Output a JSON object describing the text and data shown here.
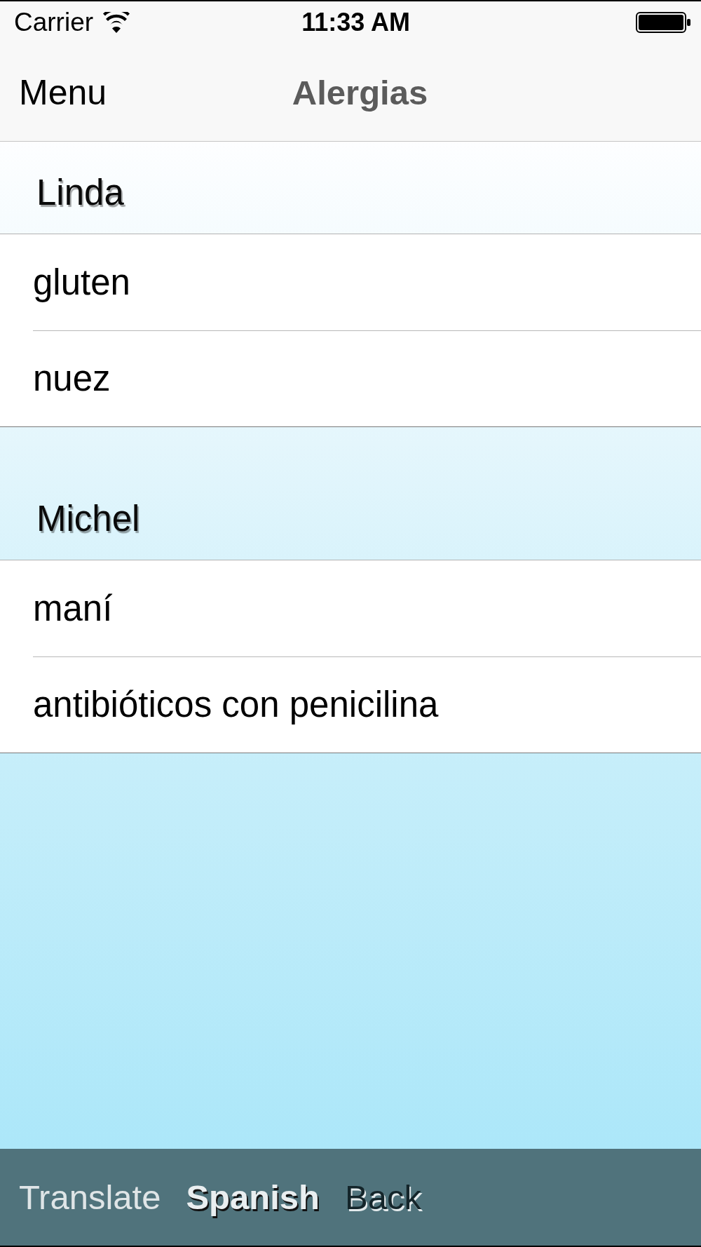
{
  "status_bar": {
    "carrier": "Carrier",
    "time": "11:33 AM"
  },
  "nav_bar": {
    "left_button": "Menu",
    "title": "Alergias"
  },
  "sections": [
    {
      "header": "Linda",
      "rows": [
        "gluten",
        "nuez"
      ]
    },
    {
      "header": "Michel",
      "rows": [
        "maní",
        "antibióticos con penicilina"
      ]
    }
  ],
  "toolbar": {
    "items": [
      {
        "label": "Translate",
        "kind": "plain"
      },
      {
        "label": "Spanish",
        "kind": "bold"
      },
      {
        "label": "Back",
        "kind": "embossed"
      }
    ]
  }
}
